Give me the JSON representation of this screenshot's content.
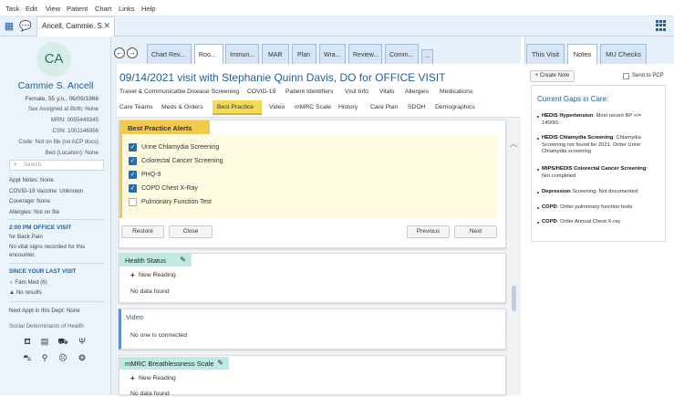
{
  "menu": [
    "Task",
    "Edit",
    "View",
    "Patient",
    "Chart",
    "Links",
    "Help"
  ],
  "patient_tab": {
    "label": "Ancell, Cammie. S.",
    "close": "✕"
  },
  "patient": {
    "initials": "CA",
    "name": "Cammie S. Ancell",
    "info": [
      "Female, 55 y.o., 06/09/1966",
      "Sex Assigned at Birth: None",
      "MRN: 0055449345",
      "CSN: 1001146956",
      "Code: Not on file (no ACP docs)",
      "Bed (Location): None"
    ],
    "search_placeholder": "Search",
    "details": [
      "Appt Notes: None",
      "COVID-19 Vaccine: Unknown",
      "Coverage: None",
      "Allergies: Not on file"
    ],
    "visit_title": "2:00 PM OFFICE VISIT",
    "visit_reason": "for Back Pain",
    "vitals_note": [
      "No vital signs recorded for this",
      "encounter."
    ],
    "since_title": "SINCE YOUR LAST VISIT",
    "since_items": [
      "Fam Med (6)",
      "No results"
    ],
    "next_appt": "Next Appt in this Dept: None",
    "sdoh_title": "Social Determinants of Health"
  },
  "activity_tabs": [
    "Chart Rev...",
    "Roo...",
    "Immun...",
    "MAR",
    "Plan",
    "Wra...",
    "Review...",
    "Comm...",
    "..."
  ],
  "visit": {
    "title": "09/14/2021 visit with Stephanie Quinn Davis, DO for OFFICE VISIT",
    "nav_row1": [
      "Travel & Communicable Disease Screening",
      "COVID-19",
      "Patient Identifiers",
      "Visit Info",
      "Vitals",
      "Allergies",
      "Medications"
    ],
    "nav_row2": [
      "Care Teams",
      "Meds & Orders",
      "Best Practice",
      "Video",
      "mMRC Scale",
      "History",
      "Care Plan",
      "SDOH",
      "Demographics"
    ]
  },
  "bpa": {
    "title": "Best Practice Alerts",
    "items": [
      {
        "label": "Urine Chlamydia Screening",
        "checked": true
      },
      {
        "label": "Colorectal Cancer Screening",
        "checked": true
      },
      {
        "label": "PHQ-9",
        "checked": true
      },
      {
        "label": "COPD Chest X-Ray",
        "checked": true
      },
      {
        "label": "Pulmonary Function Test",
        "checked": false
      }
    ],
    "buttons": {
      "restore": "Restore",
      "close": "Close",
      "previous": "Previous",
      "next": "Next"
    }
  },
  "health_status": {
    "title": "Health Status",
    "new_reading": "New Reading",
    "empty": "No data found"
  },
  "video": {
    "title": "Video",
    "empty": "No one is connected"
  },
  "mmrc": {
    "title": "mMRC Breathlessness Scale",
    "new_reading": "New Reading",
    "empty": "No data found"
  },
  "right_tabs": [
    "This Visit",
    "Notes",
    "MU Checks"
  ],
  "right": {
    "create_note": "+ Create Note",
    "send_to_pcp": "Send to PCP",
    "gaps_title": "Current Gaps in Care:",
    "gaps": [
      {
        "bold": "HEDIS Hypertension",
        "text": ": Most recent BP >/= 140/90."
      },
      {
        "bold": "HEDIS Chlamydia Screening",
        "text": ": Chlamydia Screening not found for 2021. Order Urine Chlamydia screening"
      },
      {
        "bold": "MIPS/HEDIS Colorectal Cancer Screening",
        "text": ": Not completed"
      },
      {
        "bold": "Depression",
        "text": " Screening: Not documented"
      },
      {
        "bold": "COPD",
        "text": ": Order pulmonary function tests"
      },
      {
        "bold": "COPD",
        "text": ": Order Annual Chest X-ray"
      }
    ]
  },
  "colors": {
    "accent": "#1f5e9a",
    "bpa_yellow": "#f3c94b",
    "section_teal": "#bfeae4",
    "checkbox": "#1e6fb8"
  }
}
